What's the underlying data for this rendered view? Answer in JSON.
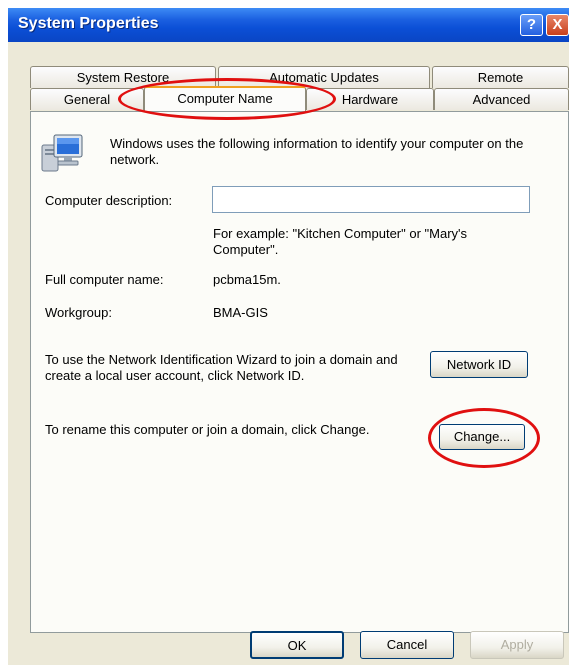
{
  "window": {
    "title": "System Properties",
    "help_glyph": "?",
    "close_glyph": "X"
  },
  "tabs": {
    "row1": [
      "System Restore",
      "Automatic Updates",
      "Remote"
    ],
    "row2": [
      "General",
      "Computer Name",
      "Hardware",
      "Advanced"
    ],
    "active": "Computer Name"
  },
  "content": {
    "intro": "Windows uses the following information to identify your computer on the network.",
    "description_label": "Computer description:",
    "description_value": "",
    "example": "For example: \"Kitchen Computer\" or \"Mary's Computer\".",
    "full_name_label": "Full computer name:",
    "full_name_value": "pcbma15m.",
    "workgroup_label": "Workgroup:",
    "workgroup_value": "BMA-GIS",
    "network_id_text": "To use the Network Identification Wizard to join a domain and create a local user account, click Network ID.",
    "network_id_button": "Network ID",
    "rename_text": "To rename this computer or join a domain, click Change.",
    "change_button": "Change..."
  },
  "footer": {
    "ok": "OK",
    "cancel": "Cancel",
    "apply": "Apply"
  },
  "colors": {
    "highlight_circle": "#e01010",
    "title_bar": "#0b4fd6"
  }
}
